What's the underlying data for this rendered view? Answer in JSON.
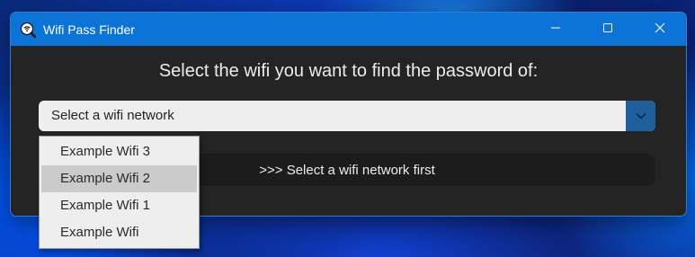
{
  "window": {
    "title": "Wifi Pass Finder",
    "icon": "wifi-search-icon",
    "controls": [
      "minimize-icon",
      "maximize-icon",
      "close-icon"
    ]
  },
  "main": {
    "heading": "Select the wifi you want to find the password of:",
    "combo": {
      "selected_text": "Select a wifi network",
      "arrow_icon": "chevron-down-icon"
    },
    "find_button_label": ">>> Select a wifi network first",
    "dropdown": {
      "options": [
        "Example Wifi 3",
        "Example Wifi 2",
        "Example Wifi 1",
        "Example Wifi"
      ],
      "hovered": "Example Wifi 2"
    }
  },
  "colors": {
    "titlebar": "#0b74d6",
    "window_bg": "#242424",
    "accent": "#1f5f9c"
  }
}
